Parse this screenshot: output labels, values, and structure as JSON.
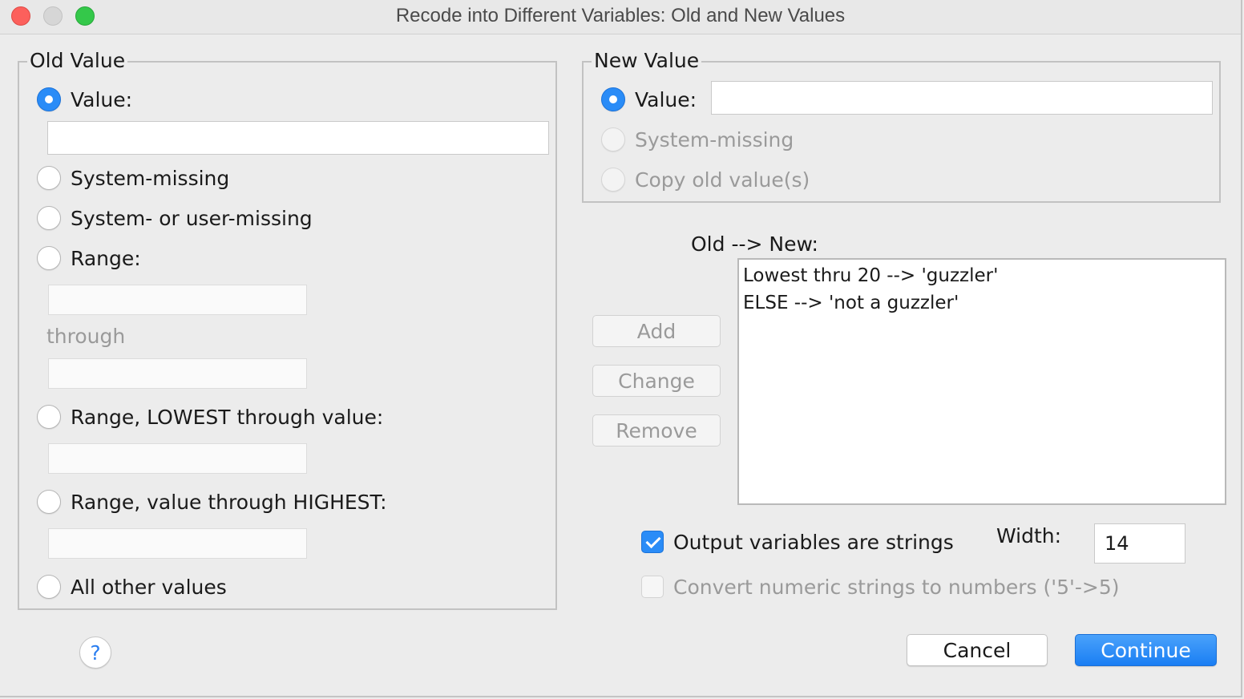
{
  "window": {
    "title": "Recode into Different Variables: Old and New Values"
  },
  "old_value": {
    "legend": "Old Value",
    "value_label": "Value:",
    "value_input": "",
    "system_missing_label": "System-missing",
    "system_user_missing_label": "System- or user-missing",
    "range_label": "Range:",
    "range_from": "",
    "through_label": "through",
    "range_to": "",
    "range_lowest_label": "Range, LOWEST through value:",
    "range_lowest_input": "",
    "range_highest_label": "Range, value through HIGHEST:",
    "range_highest_input": "",
    "all_other_label": "All other values",
    "selected": "value"
  },
  "new_value": {
    "legend": "New Value",
    "value_label": "Value:",
    "value_input": "",
    "system_missing_label": "System-missing",
    "copy_old_label": "Copy old value(s)",
    "selected": "value"
  },
  "mapping": {
    "header": "Old --> New:",
    "items": [
      "Lowest thru 20 --> 'guzzler'",
      "ELSE --> 'not a guzzler'"
    ]
  },
  "buttons": {
    "add": "Add",
    "change": "Change",
    "remove": "Remove",
    "cancel": "Cancel",
    "continue": "Continue",
    "help": "?"
  },
  "options": {
    "output_strings_label": "Output variables are strings",
    "output_strings_checked": true,
    "width_label": "Width:",
    "width_value": "14",
    "convert_numeric_label": "Convert numeric strings to numbers ('5'->5)",
    "convert_numeric_checked": false
  },
  "colors": {
    "accent": "#2a8cf7",
    "background": "#ececec"
  }
}
